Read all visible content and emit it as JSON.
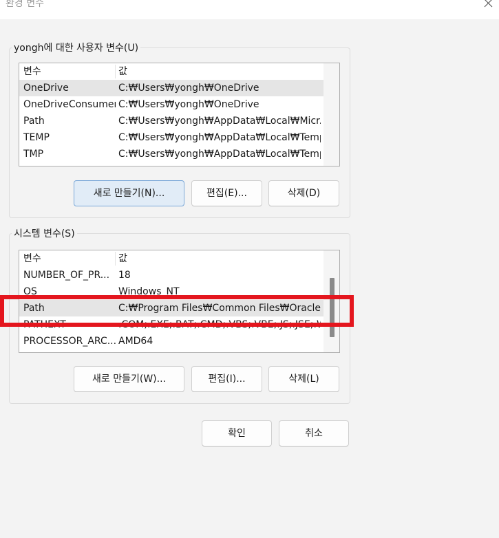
{
  "window": {
    "title": "환경 변수"
  },
  "user_vars": {
    "group_label": "yongh에 대한 사용자 변수(U)",
    "columns": [
      "변수",
      "값"
    ],
    "rows": [
      {
        "name": "OneDrive",
        "value": "C:₩Users₩yongh₩OneDrive",
        "selected": true
      },
      {
        "name": "OneDriveConsumer",
        "value": "C:₩Users₩yongh₩OneDrive",
        "selected": false
      },
      {
        "name": "Path",
        "value": "C:₩Users₩yongh₩AppData₩Local₩Micr...",
        "selected": false
      },
      {
        "name": "TEMP",
        "value": "C:₩Users₩yongh₩AppData₩Local₩Temp",
        "selected": false
      },
      {
        "name": "TMP",
        "value": "C:₩Users₩yongh₩AppData₩Local₩Temp",
        "selected": false
      }
    ],
    "buttons": {
      "new": "새로 만들기(N)...",
      "edit": "편집(E)...",
      "delete": "삭제(D)"
    }
  },
  "system_vars": {
    "group_label": "시스템 변수(S)",
    "columns": [
      "변수",
      "값"
    ],
    "rows": [
      {
        "name": "NUMBER_OF_PR...",
        "value": "18",
        "selected": false
      },
      {
        "name": "OS",
        "value": "Windows_NT",
        "selected": false
      },
      {
        "name": "Path",
        "value": "C:₩Program Files₩Common Files₩Oracle...",
        "selected": true
      },
      {
        "name": "PATHEXT",
        "value": ".COM;.EXE;.BAT;.CMD;.VBS;.VBE;.JS;.JSE;.W...",
        "selected": false
      },
      {
        "name": "PROCESSOR_ARC...",
        "value": "AMD64",
        "selected": false
      }
    ],
    "buttons": {
      "new": "새로 만들기(W)...",
      "edit": "편집(I)...",
      "delete": "삭제(L)"
    }
  },
  "dialog_buttons": {
    "ok": "확인",
    "cancel": "취소"
  },
  "colors": {
    "highlight": "#e4161e",
    "selected_row": "#e5e5e5",
    "primary_button": "#e1ecf7"
  }
}
